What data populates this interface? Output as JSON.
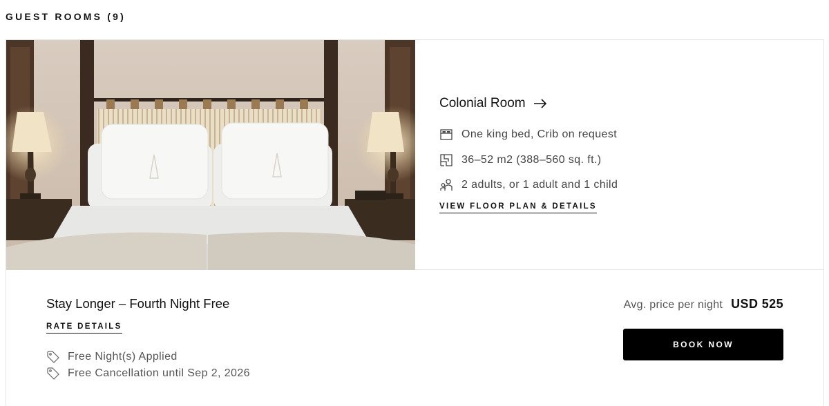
{
  "section": {
    "title": "GUEST ROOMS (9)"
  },
  "room": {
    "name": "Colonial Room",
    "features": [
      {
        "icon": "bed-icon",
        "text": "One king bed, Crib on request"
      },
      {
        "icon": "floor-plan-icon",
        "text": "36–52 m2 (388–560 sq. ft.)"
      },
      {
        "icon": "guests-icon",
        "text": "2 adults, or 1 adult and 1 child"
      }
    ],
    "floorplan_link": "VIEW FLOOR PLAN & DETAILS"
  },
  "rate": {
    "name": "Stay Longer – Fourth Night Free",
    "details_link": "RATE DETAILS",
    "perks": [
      {
        "icon": "tag-icon",
        "text": "Free Night(s) Applied"
      },
      {
        "icon": "tag-icon",
        "text": "Free Cancellation until Sep 2, 2026"
      }
    ],
    "price_label": "Avg. price per night",
    "price_value": "USD 525",
    "book_label": "BOOK NOW"
  },
  "colors": {
    "button_bg": "#000000",
    "border": "#e4e4e4",
    "text_muted": "#555555"
  }
}
